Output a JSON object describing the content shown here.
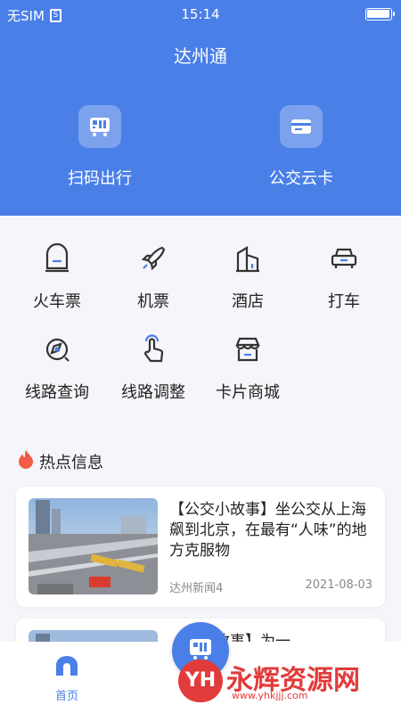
{
  "status_bar": {
    "carrier": "无SIM",
    "sim_glyph": "S",
    "time": "15:14",
    "battery_level": 0.9
  },
  "header": {
    "title": "达州通"
  },
  "hero_actions": [
    {
      "label": "扫码出行",
      "icon": "bus-qr-icon"
    },
    {
      "label": "公交云卡",
      "icon": "card-icon"
    }
  ],
  "services": [
    {
      "label": "火车票",
      "icon": "train-icon"
    },
    {
      "label": "机票",
      "icon": "plane-icon"
    },
    {
      "label": "酒店",
      "icon": "hotel-icon"
    },
    {
      "label": "打车",
      "icon": "taxi-icon"
    },
    {
      "label": "线路查询",
      "icon": "compass-icon"
    },
    {
      "label": "线路调整",
      "icon": "touch-icon"
    },
    {
      "label": "卡片商城",
      "icon": "shop-icon"
    }
  ],
  "hot_section": {
    "title": "热点信息",
    "icon": "flame-icon"
  },
  "news": [
    {
      "headline": "【公交小故事】坐公交从上海飙到北京，在最有“人味”的地方克服物",
      "source": "达州新闻4",
      "date": "2021-08-03"
    },
    {
      "headline": "【温暖故事】为一",
      "source": "",
      "date": ""
    }
  ],
  "tabbar": {
    "home_label": "首页"
  },
  "watermark": {
    "logo": "YH",
    "text": "永辉资源网",
    "url": "www.yhkjjj.com"
  },
  "colors": {
    "primary": "#4a7fe8",
    "watermark": "#e23b3b"
  }
}
